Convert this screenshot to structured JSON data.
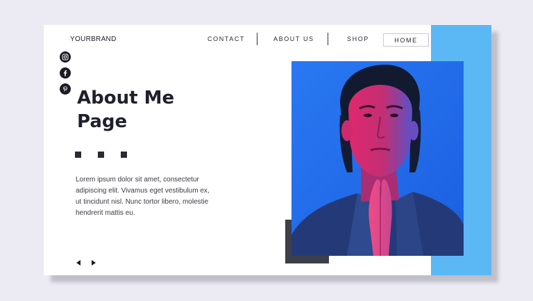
{
  "brand": {
    "name": "YOURBRAND"
  },
  "nav": {
    "contact": "CONTACT",
    "about": "ABOUT US",
    "shop": "SHOP",
    "home": "HOME"
  },
  "social": [
    {
      "icon": "instagram-icon"
    },
    {
      "icon": "facebook-icon"
    },
    {
      "icon": "pinterest-icon"
    }
  ],
  "hero": {
    "title_line1": "About Me",
    "title_line2": "Page",
    "body": "Lorem ipsum dolor sit amet, consectetur adipiscing elit. Vivamus eget vestibulum ex, ut tincidunt nisl. Nunc tortor libero, molestie hendrerit mattis eu."
  },
  "slider": {
    "prev_icon": "arrow-left-icon",
    "next_icon": "arrow-right-icon"
  },
  "colors": {
    "accent": "#5bb8f5",
    "photo_bg": "#1f6ef0",
    "dark": "#1c1c24",
    "block": "#3d3f4a",
    "background": "#ecebf4"
  }
}
